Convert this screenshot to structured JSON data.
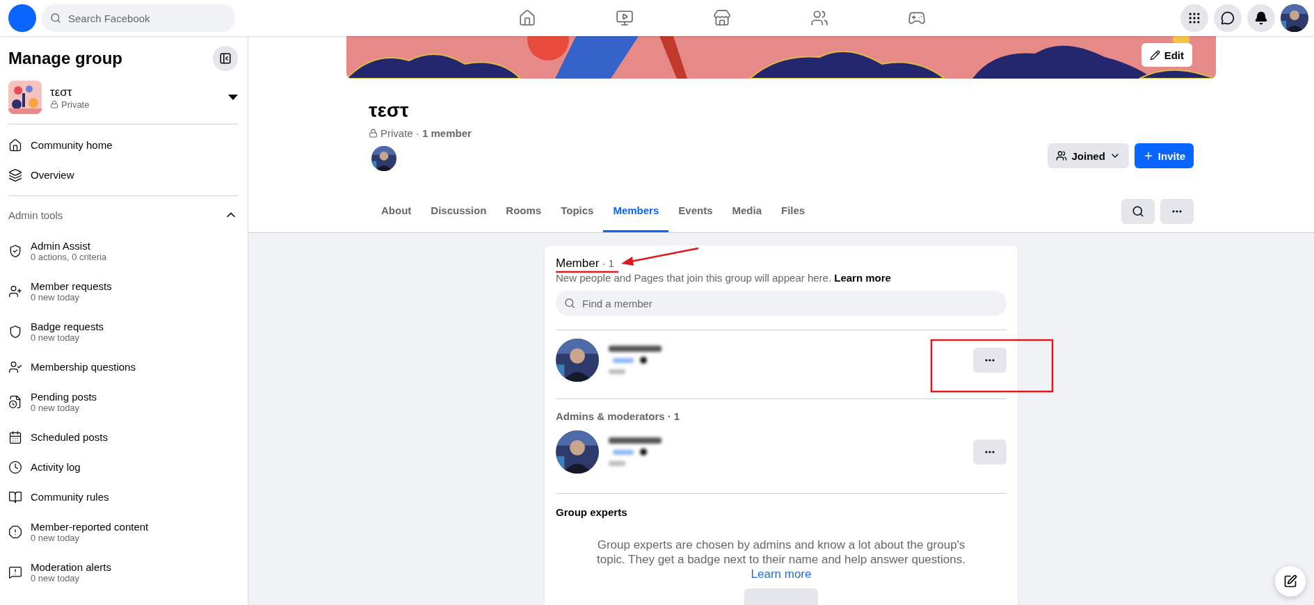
{
  "top_bar": {
    "search": {
      "placeholder": "Search Facebook"
    }
  },
  "sidebar": {
    "title": "Manage group",
    "group": {
      "name": "τεστ",
      "privacy": "Private"
    },
    "nav": [
      {
        "label": "Community home"
      },
      {
        "label": "Overview"
      }
    ],
    "admin_tools": {
      "title": "Admin tools",
      "expanded": true,
      "items": [
        {
          "label": "Admin Assist",
          "sub": "0 actions, 0 criteria"
        },
        {
          "label": "Member requests",
          "sub": "0 new today"
        },
        {
          "label": "Badge requests",
          "sub": "0 new today"
        },
        {
          "label": "Membership questions"
        },
        {
          "label": "Pending posts",
          "sub": "0 new today"
        },
        {
          "label": "Scheduled posts"
        },
        {
          "label": "Activity log"
        },
        {
          "label": "Community rules"
        },
        {
          "label": "Member-reported content",
          "sub": "0 new today"
        },
        {
          "label": "Moderation alerts",
          "sub": "0 new today"
        }
      ]
    }
  },
  "group_header": {
    "edit_label": "Edit",
    "name": "τεστ",
    "privacy_line": "Private · **1 member**",
    "joined_label": "Joined",
    "invite_label": "Invite",
    "tabs": [
      {
        "label": "About",
        "selected": false
      },
      {
        "label": "Discussion",
        "selected": false
      },
      {
        "label": "Rooms",
        "selected": false
      },
      {
        "label": "Topics",
        "selected": false
      },
      {
        "label": "Members",
        "selected": true
      },
      {
        "label": "Events",
        "selected": false
      },
      {
        "label": "Media",
        "selected": false
      },
      {
        "label": "Files",
        "selected": false
      }
    ]
  },
  "members_card": {
    "title": "Member",
    "count": "· 1",
    "description": "New people and Pages that join this group will appear here.",
    "learn_more": "Learn more",
    "search_placeholder": "Find a member",
    "admins_title": "Admins & moderators",
    "admins_count": "· 1",
    "experts_title": "Group experts",
    "experts_description": "Group experts are chosen by admins and know a lot about the group's topic. They get a badge next to their name and help answer questions.",
    "experts_learn_more": "Learn more"
  }
}
